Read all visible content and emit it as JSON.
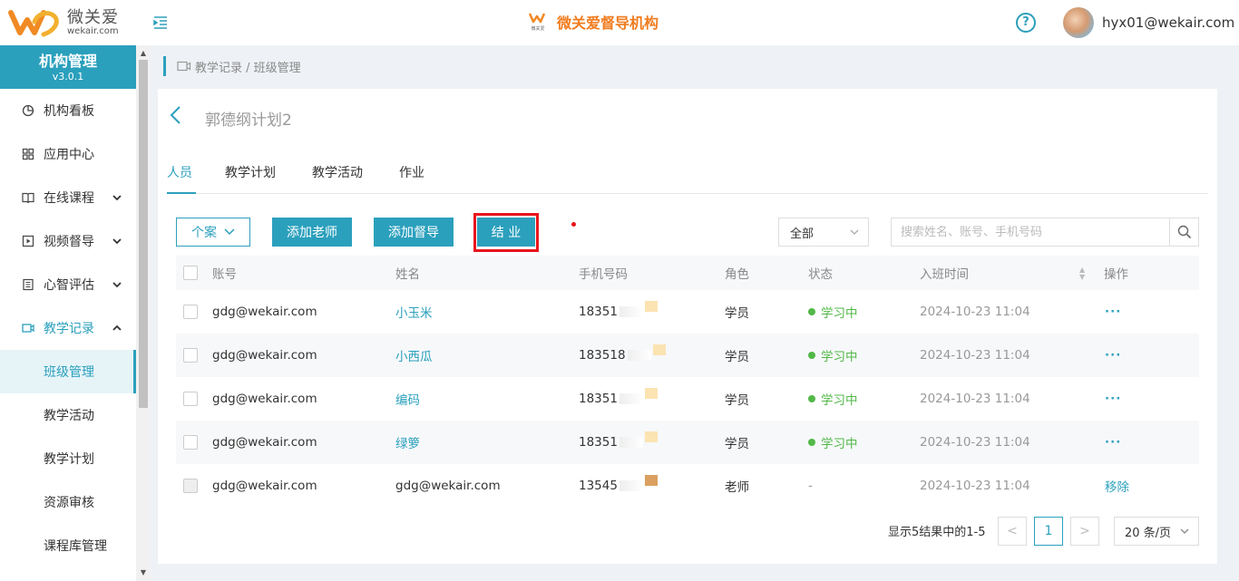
{
  "header": {
    "logo_cn": "微关爱",
    "logo_en": "wekair.com",
    "brand_title": "微关爱督导机构",
    "brand_mark_text": "微关爱",
    "user_email": "hyx01@wekair.com",
    "help_glyph": "?"
  },
  "sidebar": {
    "title": "机构管理",
    "version": "v3.0.1",
    "items": [
      {
        "label": "机构看板",
        "icon": "pie-chart-icon"
      },
      {
        "label": "应用中心",
        "icon": "grid-icon"
      },
      {
        "label": "在线课程",
        "icon": "book-icon",
        "expandable": true
      },
      {
        "label": "视频督导",
        "icon": "play-icon",
        "expandable": true
      },
      {
        "label": "心智评估",
        "icon": "clipboard-icon",
        "expandable": true
      },
      {
        "label": "教学记录",
        "icon": "video-icon",
        "expanded": true
      }
    ],
    "sub_items": [
      {
        "label": "班级管理",
        "active": true
      },
      {
        "label": "教学活动"
      },
      {
        "label": "教学计划"
      },
      {
        "label": "资源审核"
      },
      {
        "label": "课程库管理"
      }
    ]
  },
  "breadcrumb": "教学记录 / 班级管理",
  "page": {
    "title": "郭德纲计划2",
    "tabs": [
      "人员",
      "教学计划",
      "教学活动",
      "作业"
    ],
    "active_tab": 0
  },
  "toolbar": {
    "case_label": "个案",
    "add_teacher": "添加老师",
    "add_supervisor": "添加督导",
    "graduate": "结 业",
    "filter_value": "全部",
    "search_placeholder": "搜索姓名、账号、手机号码"
  },
  "table": {
    "columns": [
      "账号",
      "姓名",
      "手机号码",
      "角色",
      "状态",
      "入班时间",
      "操作"
    ],
    "rows": [
      {
        "account": "gdg@wekair.com",
        "name": "小玉米",
        "phone": "18351",
        "role": "学员",
        "status": "学习中",
        "joined": "2024-10-23 11:04",
        "action": "···"
      },
      {
        "account": "gdg@wekair.com",
        "name": "小西瓜",
        "phone": "183518",
        "role": "学员",
        "status": "学习中",
        "joined": "2024-10-23 11:04",
        "action": "···"
      },
      {
        "account": "gdg@wekair.com",
        "name": "编码",
        "phone": "18351",
        "role": "学员",
        "status": "学习中",
        "joined": "2024-10-23 11:04",
        "action": "···"
      },
      {
        "account": "gdg@wekair.com",
        "name": "绿箩",
        "phone": "18351",
        "role": "学员",
        "status": "学习中",
        "joined": "2024-10-23 11:04",
        "action": "···"
      },
      {
        "account": "gdg@wekair.com",
        "name": "gdg@wekair.com",
        "phone": "13545",
        "role": "老师",
        "status": "-",
        "joined": "2024-10-23 11:04",
        "action": "移除"
      }
    ]
  },
  "pagination": {
    "info": "显示5结果中的1-5",
    "current_page": "1",
    "prev": "<",
    "next": ">",
    "page_size": "20 条/页"
  },
  "colors": {
    "accent": "#2ba0bd",
    "brand_orange": "#f07c1f",
    "status_green": "#52b848",
    "highlight_red": "#e8141d"
  }
}
